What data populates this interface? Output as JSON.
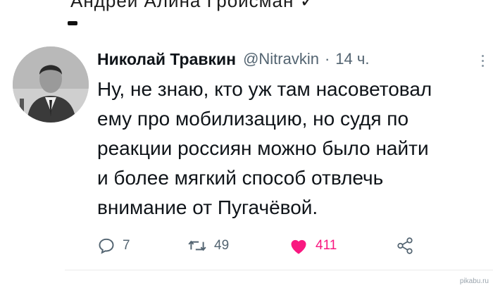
{
  "prev_tweet": {
    "cut_text": "Андрей    Алина Гройсман ✓"
  },
  "tweet": {
    "author_name": "Николай Травкин",
    "handle": "@Nitravkin",
    "separator": "·",
    "time": "14 ч.",
    "text_lines": [
      "Ну, не знаю, кто уж там насоветовал",
      "ему про мобилизацию, но судя по",
      "реакции россиян можно было найти",
      "и более мягкий способ отвлечь",
      "внимание от Пугачёвой."
    ],
    "actions": {
      "reply_count": "7",
      "retweet_count": "49",
      "like_count": "411"
    },
    "icons": {
      "reply": "reply-icon",
      "retweet": "retweet-icon",
      "like": "heart-icon",
      "share": "share-icon",
      "more": "more-options-icon"
    },
    "colors": {
      "like": "#f91880",
      "muted": "#536471"
    }
  },
  "watermark": "pikabu.ru"
}
